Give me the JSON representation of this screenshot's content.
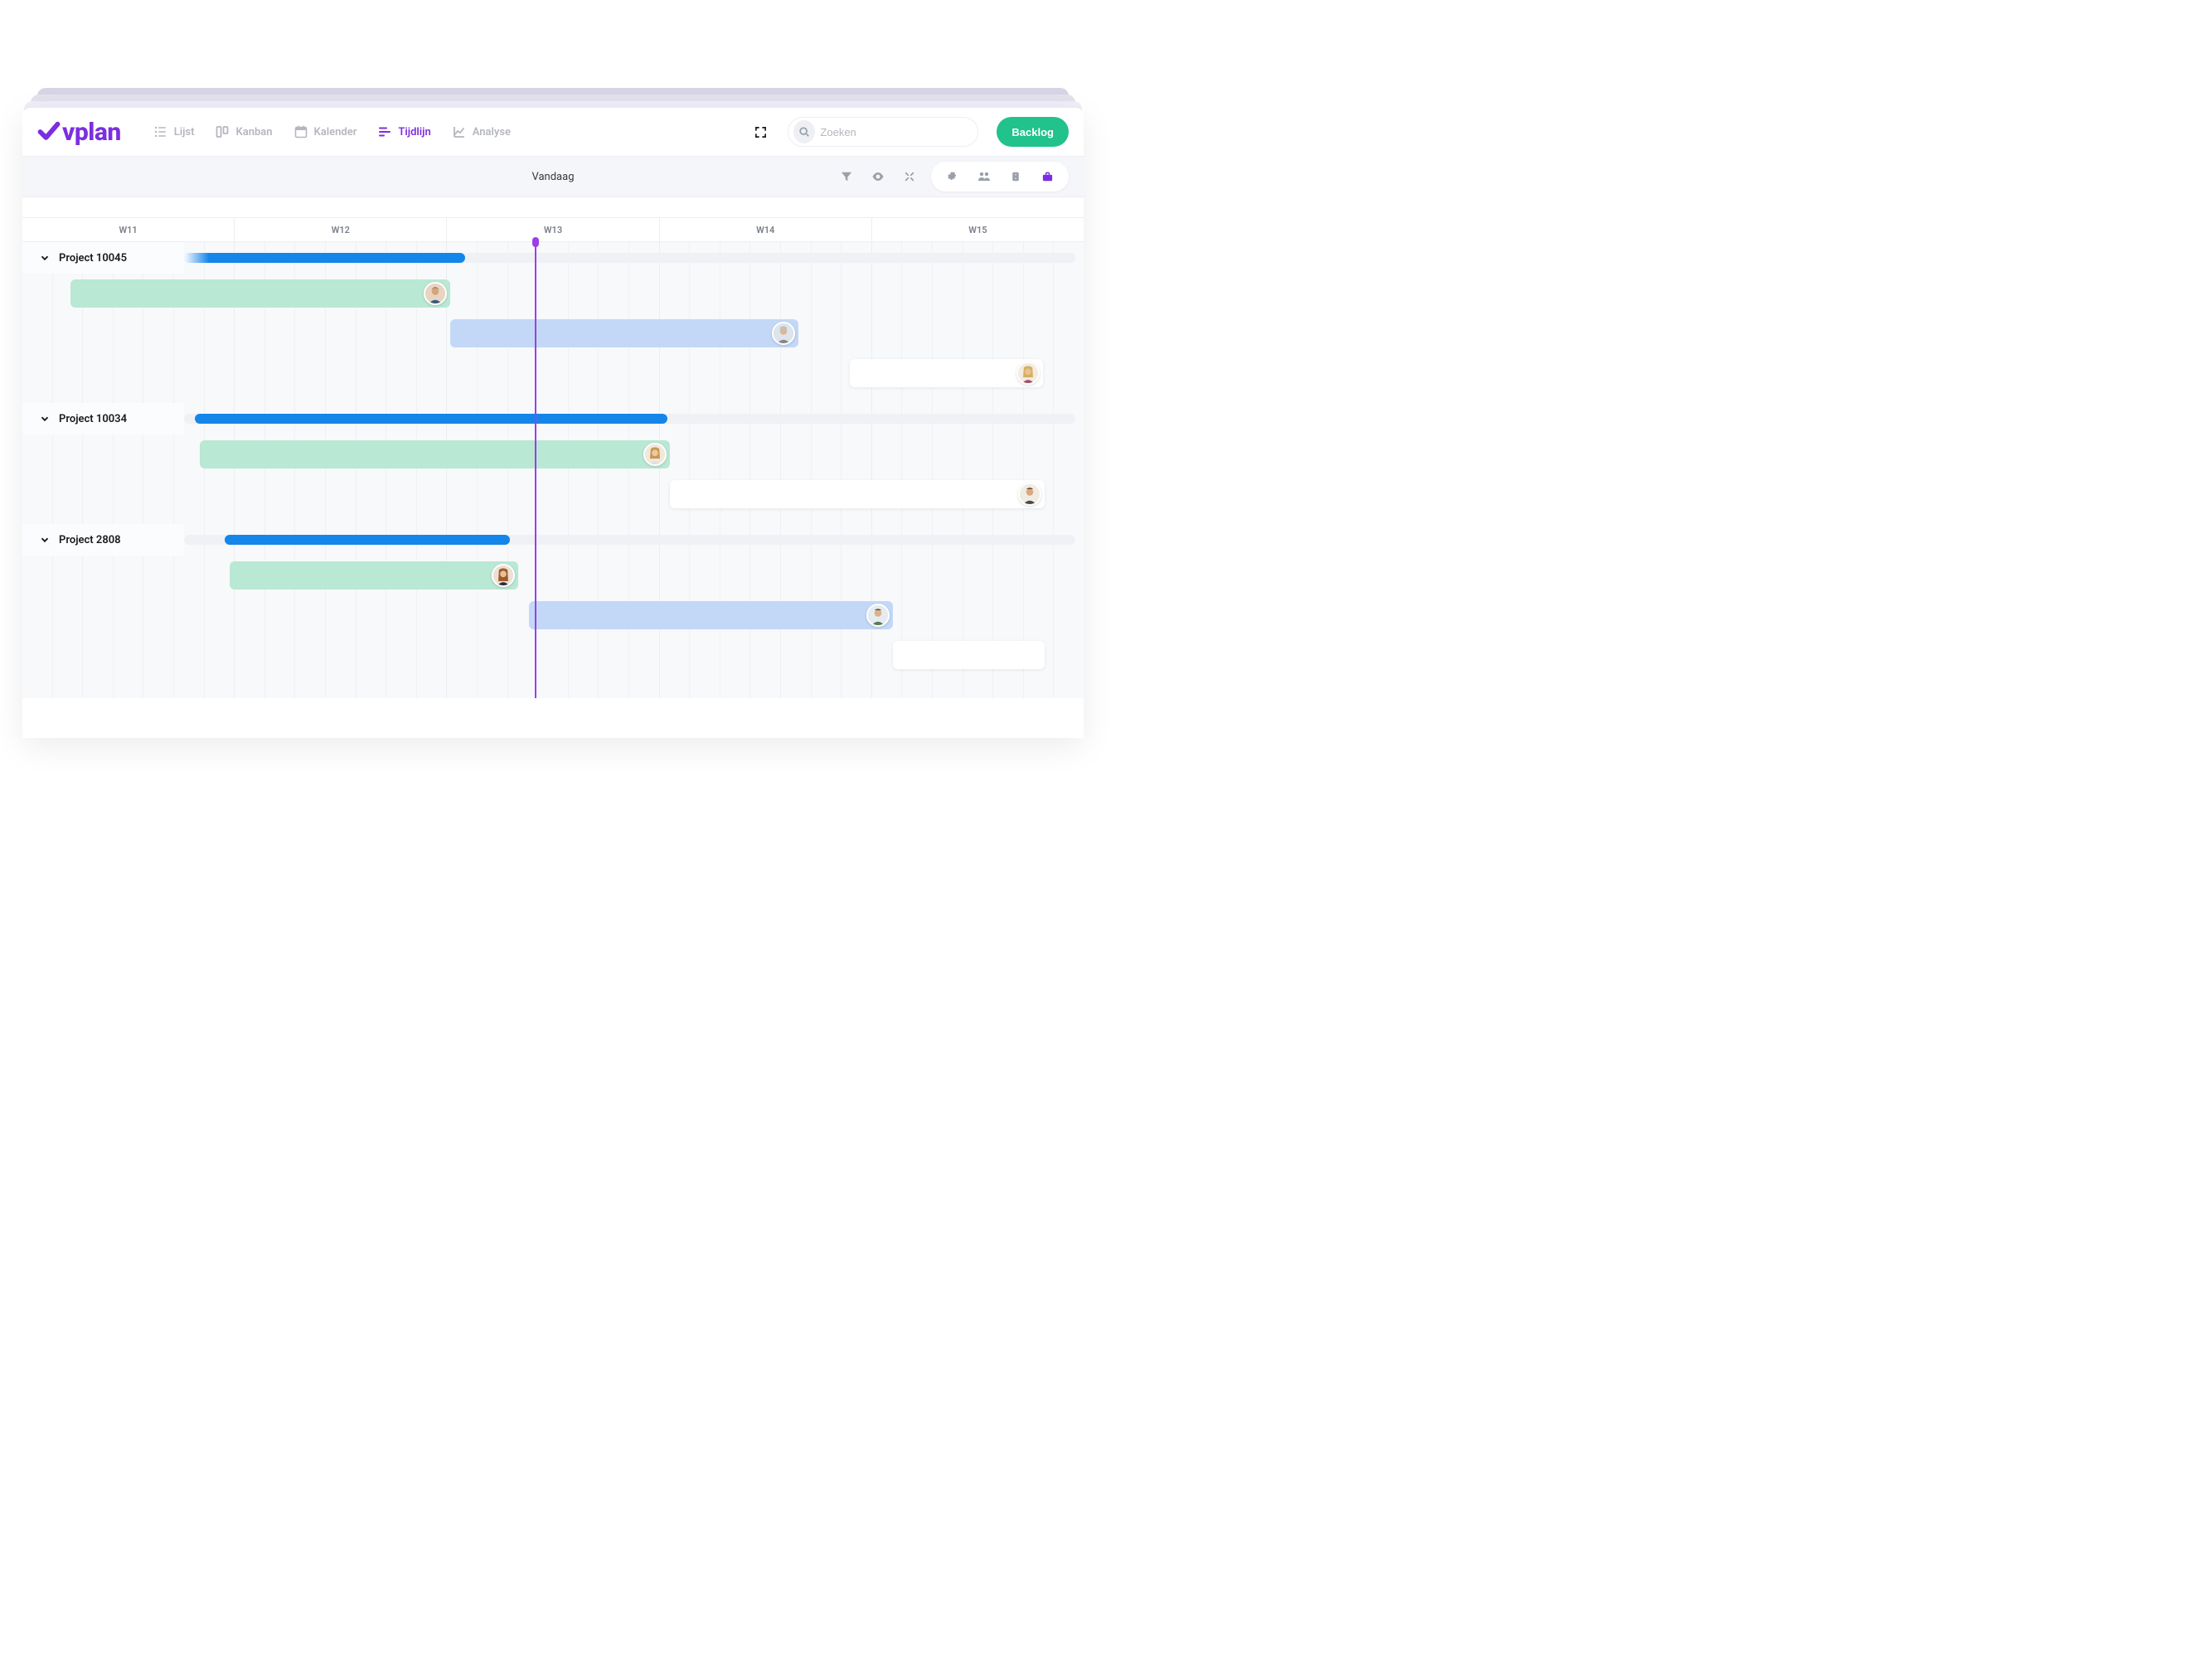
{
  "brand": "vplan",
  "nav": {
    "lijst": "Lijst",
    "kanban": "Kanban",
    "kalender": "Kalender",
    "tijdlijn": "Tijdlijn",
    "analyse": "Analyse"
  },
  "search": {
    "placeholder": "Zoeken"
  },
  "backlog_button": "Backlog",
  "toolbar": {
    "today_label": "Vandaag"
  },
  "weeks": [
    "W11",
    "W12",
    "W13",
    "W14",
    "W15"
  ],
  "today_position_pct": 48.3,
  "projects": [
    {
      "name": "Project 10045",
      "progress": {
        "start_pct": 0,
        "end_pct": 42,
        "fade_left": true
      },
      "tasks": [
        {
          "color": "green",
          "left_pct": 4.5,
          "width_pct": 35.8,
          "avatar": "m1"
        },
        {
          "color": "blue",
          "left_pct": 40.3,
          "width_pct": 32.8,
          "avatar": "m2"
        },
        {
          "color": "white",
          "left_pct": 78,
          "width_pct": 18.2,
          "avatar": "f1"
        }
      ]
    },
    {
      "name": "Project 10034",
      "progress": {
        "start_pct": 16.7,
        "end_pct": 61,
        "fade_left": false
      },
      "tasks": [
        {
          "color": "green",
          "left_pct": 16.7,
          "width_pct": 44.3,
          "avatar": "f2"
        },
        {
          "color": "white",
          "left_pct": 61,
          "width_pct": 35.3,
          "avatar": "m3"
        }
      ]
    },
    {
      "name": "Project 2808",
      "progress": {
        "start_pct": 19.5,
        "end_pct": 46.2,
        "fade_left": false
      },
      "tasks": [
        {
          "color": "green",
          "left_pct": 19.5,
          "width_pct": 27.2,
          "avatar": "f3"
        },
        {
          "color": "blue",
          "left_pct": 47.7,
          "width_pct": 34.3,
          "avatar": "m4"
        },
        {
          "color": "white",
          "left_pct": 82,
          "width_pct": 14.3,
          "avatar": ""
        }
      ]
    }
  ]
}
